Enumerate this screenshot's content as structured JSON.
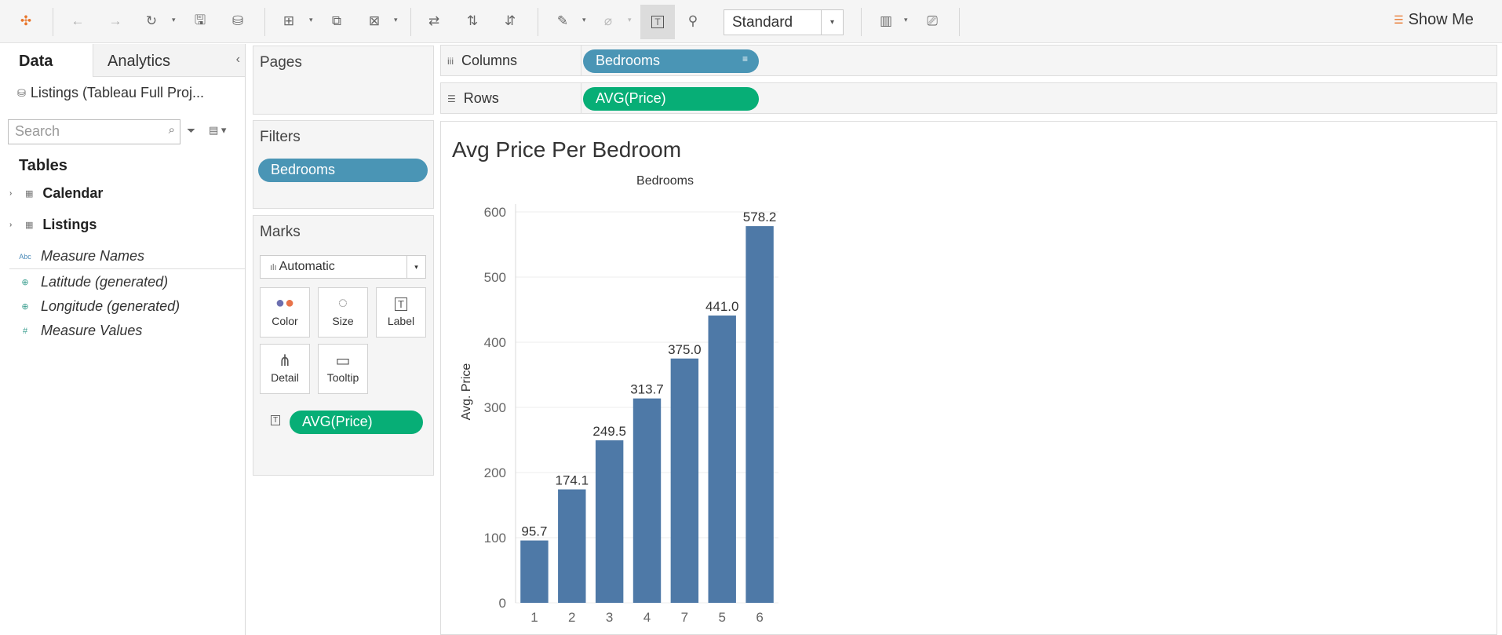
{
  "toolbar": {
    "fit_select": "Standard",
    "show_me": "Show Me"
  },
  "data_pane": {
    "tabs": {
      "data": "Data",
      "analytics": "Analytics"
    },
    "datasource": "Listings (Tableau Full Proj...",
    "search_placeholder": "Search",
    "tables_heading": "Tables",
    "tables": [
      "Calendar",
      "Listings"
    ],
    "fields": [
      "Measure Names",
      "Latitude (generated)",
      "Longitude (generated)",
      "Measure Values"
    ]
  },
  "pages": {
    "title": "Pages"
  },
  "filters": {
    "title": "Filters",
    "pill": "Bedrooms"
  },
  "marks": {
    "title": "Marks",
    "type": "Automatic",
    "buttons": {
      "color": "Color",
      "size": "Size",
      "label": "Label",
      "detail": "Detail",
      "tooltip": "Tooltip"
    },
    "label_pill": "AVG(Price)"
  },
  "shelves": {
    "columns_label": "Columns",
    "columns_pill": "Bedrooms",
    "rows_label": "Rows",
    "rows_pill": "AVG(Price)"
  },
  "colors": {
    "bar": "#4e79a7",
    "dimension_pill": "#4a95b5",
    "measure_pill": "#07ae76"
  },
  "chart_data": {
    "type": "bar",
    "title": "Avg Price Per Bedroom",
    "xlabel": "Bedrooms",
    "ylabel": "Avg. Price",
    "categories": [
      "1",
      "2",
      "3",
      "4",
      "7",
      "5",
      "6"
    ],
    "values": [
      95.7,
      174.1,
      249.5,
      313.7,
      375.0,
      441.0,
      578.2
    ],
    "value_labels": [
      "95.7",
      "174.1",
      "249.5",
      "313.7",
      "375.0",
      "441.0",
      "578.2"
    ],
    "yticks": [
      0,
      100,
      200,
      300,
      400,
      500,
      600
    ],
    "ylim": [
      0,
      600
    ],
    "grid": true
  }
}
